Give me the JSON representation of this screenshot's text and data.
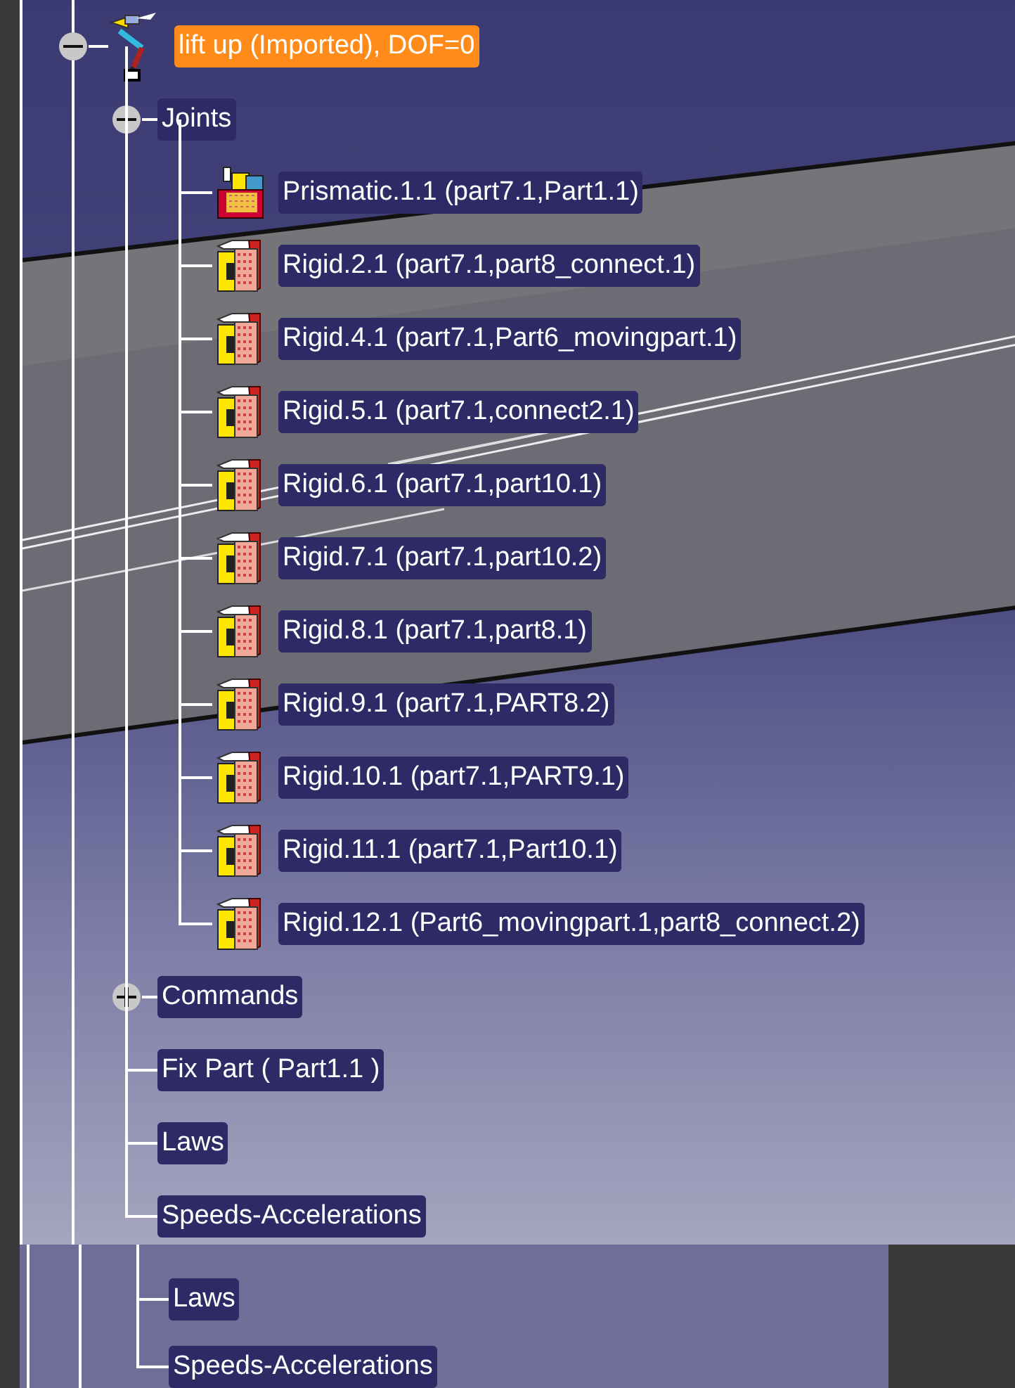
{
  "tree": {
    "label": "lift up (Imported), DOF=0",
    "kind": "mechanism",
    "selected": true,
    "expanded": true,
    "children": [
      {
        "label": "Joints",
        "selected": false,
        "expanded": true,
        "children": [
          {
            "label": "Prismatic.1.1 (part7.1,Part1.1)",
            "kind": "prismatic",
            "selected": false
          },
          {
            "label": "Rigid.2.1 (part7.1,part8_connect.1)",
            "kind": "rigid",
            "selected": false
          },
          {
            "label": "Rigid.4.1 (part7.1,Part6_movingpart.1)",
            "kind": "rigid",
            "selected": false
          },
          {
            "label": "Rigid.5.1 (part7.1,connect2.1)",
            "kind": "rigid",
            "selected": false
          },
          {
            "label": "Rigid.6.1 (part7.1,part10.1)",
            "kind": "rigid",
            "selected": false
          },
          {
            "label": "Rigid.7.1 (part7.1,part10.2)",
            "kind": "rigid",
            "selected": false
          },
          {
            "label": "Rigid.8.1 (part7.1,part8.1)",
            "kind": "rigid",
            "selected": false
          },
          {
            "label": "Rigid.9.1 (part7.1,PART8.2)",
            "kind": "rigid",
            "selected": false
          },
          {
            "label": "Rigid.10.1 (part7.1,PART9.1)",
            "kind": "rigid",
            "selected": false
          },
          {
            "label": "Rigid.11.1 (part7.1,Part10.1)",
            "kind": "rigid",
            "selected": false
          },
          {
            "label": "Rigid.12.1 (Part6_movingpart.1,part8_connect.2)",
            "kind": "rigid",
            "selected": false
          }
        ]
      },
      {
        "label": "Commands",
        "selected": false,
        "expanded": false
      },
      {
        "label": "Fix Part ( Part1.1 )",
        "selected": false
      },
      {
        "label": "Laws",
        "selected": false
      },
      {
        "label": "Speeds-Accelerations",
        "selected": false
      }
    ]
  },
  "background_tree": [
    {
      "label": "Laws",
      "selected": false
    },
    {
      "label": "Speeds-Accelerations",
      "selected": false
    }
  ]
}
